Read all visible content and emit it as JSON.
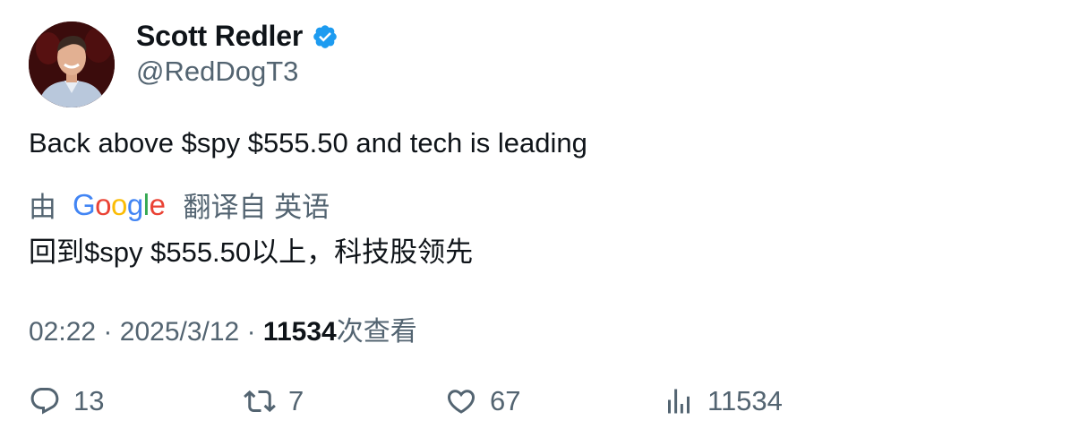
{
  "author": {
    "name": "Scott Redler",
    "handle": "@RedDogT3",
    "verified_color": "#1d9bf0"
  },
  "tweet": {
    "text": "Back above $spy $555.50 and tech is leading",
    "translation_prefix": "由",
    "translation_provider": "Google",
    "translation_suffix": "翻译自 英语",
    "translated_text": "回到$spy $555.50以上，科技股领先"
  },
  "meta": {
    "time": "02:22",
    "separator": "·",
    "date": "2025/3/12",
    "views_count": "11534",
    "views_label": "次查看"
  },
  "actions": {
    "reply_count": "13",
    "retweet_count": "7",
    "like_count": "67",
    "view_count": "11534"
  },
  "icons": {
    "avatar": "avatar-photo",
    "verified": "verified-badge-icon",
    "reply": "reply-icon",
    "retweet": "retweet-icon",
    "like": "heart-icon",
    "views": "bar-chart-icon"
  }
}
